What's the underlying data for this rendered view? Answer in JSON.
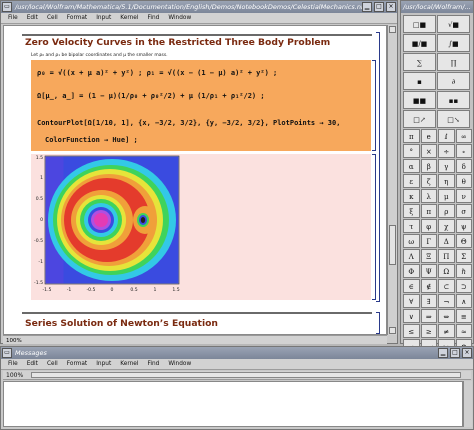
{
  "notebook": {
    "title": "/usr/local/Wolfram/Mathematica/5.1/Documentation/English/Demos/NotebookDemos/CelestialMechanics.nb *",
    "menu": [
      "File",
      "Edit",
      "Cell",
      "Format",
      "Input",
      "Kernel",
      "Find",
      "Window"
    ],
    "section1_title": "Zero Velocity Curves in the Restricted Three Body Problem",
    "text_line": "Let ρ₀ and ρ₁ be bipolar coordinates and μ the smaller mass.",
    "input_line1": "ρ₀ = √((x + μ a)² + y²) ; ρ₁ = √((x − (1 − μ) a)² + y²) ;",
    "input_line2": "Ω[μ_, a_] = (1 − μ)(1/ρ₀ + ρ₀²/2) + μ (1/ρ₁ + ρ₁²/2) ;",
    "input_line3": "ContourPlot[Ω[1/10, 1],   {x, −3/2, 3/2}, {y, −3/2, 3/2}, PlotPoints → 30,",
    "input_line4": "ColorFunction → Hue] ;",
    "plot_ticks_y": [
      "1.5",
      "1",
      "0.5",
      "0",
      "-0.5",
      "-1",
      "-1.5"
    ],
    "plot_ticks_x": [
      "-1.5",
      "-1",
      "-0.5",
      "0",
      "0.5",
      "1",
      "1.5"
    ],
    "section2_title": "Series Solution of Newton’s Equation",
    "zoom": "100%"
  },
  "palette": {
    "title": "/usr/local/Wolfram/..."
  },
  "messages": {
    "title": "Messages",
    "menu": [
      "File",
      "Edit",
      "Cell",
      "Format",
      "Input",
      "Kernel",
      "Find",
      "Window"
    ],
    "zoom": "100%"
  },
  "colors": {
    "input_bg": "#f7a85c",
    "output_bg": "#fbe1df",
    "section_text": "#7a2a10",
    "titlebar": "#8a93a6"
  }
}
